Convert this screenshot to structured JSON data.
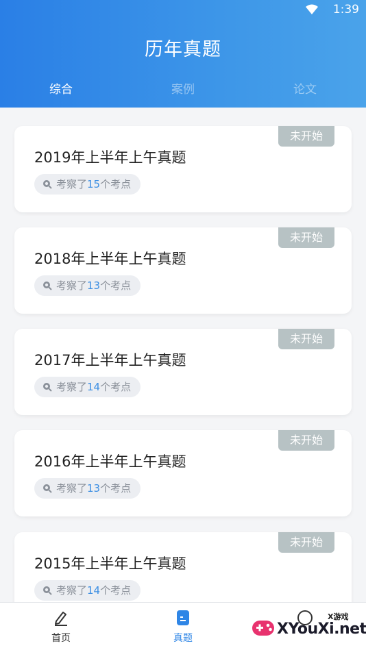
{
  "status_bar": {
    "time": "1:39"
  },
  "header": {
    "title": "历年真题"
  },
  "tabs": [
    {
      "label": "综合"
    },
    {
      "label": "案例"
    },
    {
      "label": "论文"
    }
  ],
  "cards": [
    {
      "badge": "未开始",
      "title": "2019年上半年上午真题",
      "prefix": "考察了",
      "count": "15",
      "suffix": "个考点"
    },
    {
      "badge": "未开始",
      "title": "2018年上半年上午真题",
      "prefix": "考察了",
      "count": "13",
      "suffix": "个考点"
    },
    {
      "badge": "未开始",
      "title": "2017年上半年上午真题",
      "prefix": "考察了",
      "count": "14",
      "suffix": "个考点"
    },
    {
      "badge": "未开始",
      "title": "2016年上半年上午真题",
      "prefix": "考察了",
      "count": "13",
      "suffix": "个考点"
    },
    {
      "badge": "未开始",
      "title": "2015年上半年上午真题",
      "prefix": "考察了",
      "count": "14",
      "suffix": "个考点"
    }
  ],
  "bottom_nav": [
    {
      "label": "首页",
      "icon": "edit-icon"
    },
    {
      "label": "真题",
      "icon": "document-icon"
    },
    {
      "label": "",
      "icon": "question-icon"
    }
  ],
  "watermark": {
    "small": "X游戏",
    "big": "XYouXi.net"
  },
  "colors": {
    "accent": "#2f86e6",
    "badge": "#b7c2c4",
    "count": "#3d8fe3"
  }
}
